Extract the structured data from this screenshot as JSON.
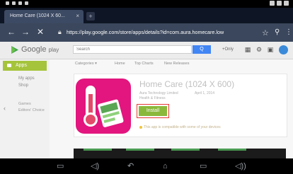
{
  "browser": {
    "tab_title": "Home Care (1024 X 60...",
    "tab_close": "×",
    "newtab_label": "+",
    "url": "https://play.google.com/store/apps/details?id=com.aura.homecare.low",
    "back_icon": "back-arrow-icon",
    "forward_icon": "forward-arrow-icon",
    "close_icon": "close-icon",
    "lock_icon": "lock-icon",
    "star_icon": "star-icon",
    "search_icon": "search-icon",
    "menu_icon": "menu-icon"
  },
  "header": {
    "logo_text": "Google",
    "logo_small": "play",
    "search_placeholder": "Search",
    "search_button_label": "Q",
    "user_name": "+Only"
  },
  "sidebar": {
    "apps_label": "Apps",
    "links": [
      "My apps",
      "Shop"
    ],
    "sublinks": [
      "Games",
      "Editors' Choice"
    ]
  },
  "subnav": {
    "items": [
      "Categories ▾",
      "Home",
      "Top Charts",
      "New Releases"
    ]
  },
  "app": {
    "title": "Home Care (1024 X 600)",
    "developer": "Aura Technology Limited",
    "category": "Health & Fitness",
    "rating_date": "April 1, 2014",
    "install_label": "Install",
    "warning_text": "This app is compatible with some of your devices"
  },
  "colors": {
    "accent_green": "#8ab83c",
    "highlight_red": "#e53935",
    "app_icon_pink": "#e2167e",
    "search_blue": "#4285f4"
  },
  "navbar": {
    "icons": [
      "screenshot-icon",
      "volume-down-icon",
      "back-icon",
      "home-icon",
      "recents-icon",
      "volume-up-icon"
    ]
  }
}
